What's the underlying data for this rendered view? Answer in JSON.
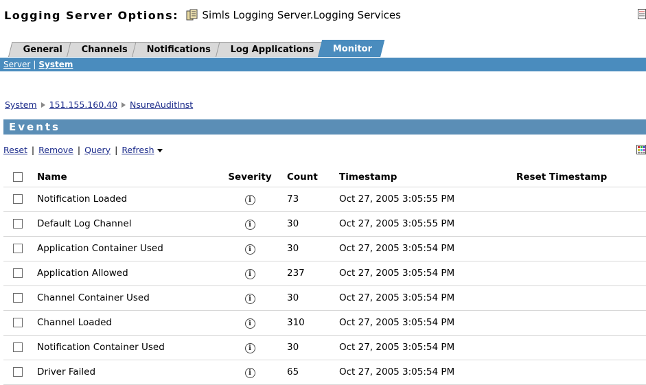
{
  "header": {
    "title": "Logging Server Options",
    "colon": ":",
    "object_name": "Simls Logging Server.Logging Services"
  },
  "tabs": [
    {
      "label": "General",
      "active": false
    },
    {
      "label": "Channels",
      "active": false
    },
    {
      "label": "Notifications",
      "active": false
    },
    {
      "label": "Log Applications",
      "active": false
    },
    {
      "label": "Monitor",
      "active": true
    }
  ],
  "subnav": {
    "items": [
      {
        "label": "Server",
        "selected": false
      },
      {
        "label": "System",
        "selected": true
      }
    ],
    "separator": "|"
  },
  "breadcrumb": [
    "System",
    "151.155.160.40",
    "NsureAuditInst"
  ],
  "events_panel": {
    "title": "Events",
    "actions": [
      "Reset",
      "Remove",
      "Query",
      "Refresh"
    ],
    "separator": "|"
  },
  "table": {
    "columns": [
      "Name",
      "Severity",
      "Count",
      "Timestamp",
      "Reset Timestamp"
    ],
    "rows": [
      {
        "name": "Notification Loaded",
        "severity": "i",
        "count": "73",
        "timestamp": "Oct 27, 2005 3:05:55 PM",
        "reset": ""
      },
      {
        "name": "Default Log Channel",
        "severity": "i",
        "count": "30",
        "timestamp": "Oct 27, 2005 3:05:55 PM",
        "reset": ""
      },
      {
        "name": "Application Container Used",
        "severity": "i",
        "count": "30",
        "timestamp": "Oct 27, 2005 3:05:54 PM",
        "reset": ""
      },
      {
        "name": "Application Allowed",
        "severity": "i",
        "count": "237",
        "timestamp": "Oct 27, 2005 3:05:54 PM",
        "reset": ""
      },
      {
        "name": "Channel Container Used",
        "severity": "i",
        "count": "30",
        "timestamp": "Oct 27, 2005 3:05:54 PM",
        "reset": ""
      },
      {
        "name": "Channel Loaded",
        "severity": "i",
        "count": "310",
        "timestamp": "Oct 27, 2005 3:05:54 PM",
        "reset": ""
      },
      {
        "name": "Notification Container Used",
        "severity": "i",
        "count": "30",
        "timestamp": "Oct 27, 2005 3:05:54 PM",
        "reset": ""
      },
      {
        "name": "Driver Failed",
        "severity": "i",
        "count": "65",
        "timestamp": "Oct 27, 2005 3:05:54 PM",
        "reset": ""
      }
    ]
  },
  "icons": {
    "server": "server-object-icon",
    "corner": "edit-properties-icon",
    "grid": "column-chooser-icon",
    "severity": "info-icon"
  },
  "colors": {
    "accent": "#4a8cbe",
    "events_header": "#5b8eb6",
    "link": "#1a2a8a",
    "tab_inactive": "#d9d9d9"
  }
}
